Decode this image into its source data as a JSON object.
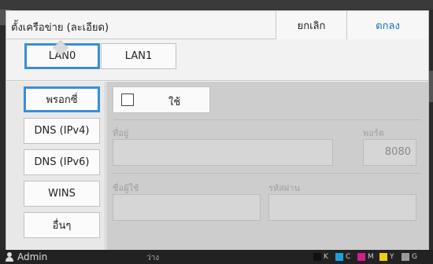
{
  "dialog": {
    "title": "ตั้งเครือข่าย (ละเอียด)",
    "cancel_label": "ยกเลิก",
    "ok_label": "ตกลง"
  },
  "tabs": [
    {
      "label": "LAN0",
      "selected": true
    },
    {
      "label": "LAN1",
      "selected": false
    }
  ],
  "sidebar": {
    "items": [
      {
        "label": "พรอกซี่",
        "selected": true
      },
      {
        "label": "DNS (IPv4)",
        "selected": false
      },
      {
        "label": "DNS (IPv6)",
        "selected": false
      },
      {
        "label": "WINS",
        "selected": false
      },
      {
        "label": "อื่นๆ",
        "selected": false
      }
    ]
  },
  "proxy": {
    "use_label": "ใช้",
    "use_checked": false,
    "address_label": "ที่อยู่",
    "address_value": "",
    "port_label": "พอร์ต",
    "port_value": "8080",
    "username_label": "ชื่อผู้ใช้",
    "username_value": "",
    "password_label": "รหัสผ่าน",
    "password_value": ""
  },
  "statusbar": {
    "user": "Admin",
    "state": "ว่าง",
    "inks": [
      {
        "label": "K",
        "color": "#111111"
      },
      {
        "label": "C",
        "color": "#1aa0e0"
      },
      {
        "label": "M",
        "color": "#d0208a"
      },
      {
        "label": "Y",
        "color": "#f0d000"
      },
      {
        "label": "G",
        "color": "#999999"
      }
    ]
  },
  "colors": {
    "accent": "#3a8fd6",
    "ok_text": "#1f6fc0"
  }
}
